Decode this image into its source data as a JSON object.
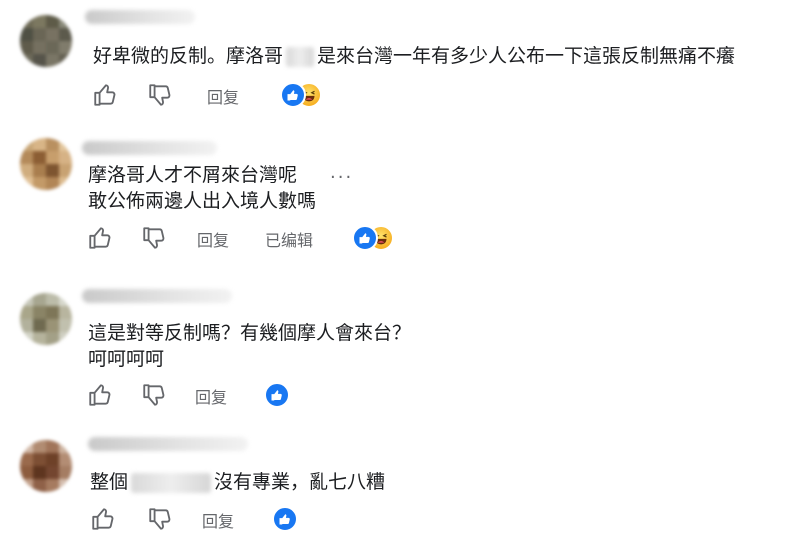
{
  "actions": {
    "reply_label": "回复",
    "edited_label": "已编辑"
  },
  "icons": {
    "like": "thumbs-up-outline-icon",
    "dislike": "thumbs-down-outline-icon",
    "like_reaction": "like-reaction-icon",
    "haha_reaction": "haha-reaction-icon",
    "more": "more-dots-icon"
  },
  "colors": {
    "accent": "#1877f2",
    "muted_text": "#65676b",
    "text": "#1c1e21",
    "haha": "#f7b125"
  },
  "comments": [
    {
      "line1_before": "好卑微的反制。摩洛哥",
      "line1_after": "是來台灣一年有多少人公布一下這張反制無痛不癢",
      "reactions": [
        "like",
        "haha"
      ],
      "edited": false
    },
    {
      "line1": "摩洛哥人才不屑來台灣呢",
      "line2": "敢公佈兩邊人出入境人數嗎",
      "more_label": "...",
      "reactions": [
        "like",
        "haha"
      ],
      "edited": true
    },
    {
      "line1": "這是對等反制嗎？有幾個摩人會來台？",
      "line2": "呵呵呵呵",
      "reactions": [
        "like"
      ],
      "edited": false
    },
    {
      "line1_before": "整個",
      "line1_after": "沒有專業，亂七八糟",
      "reactions": [
        "like"
      ],
      "edited": false
    }
  ]
}
